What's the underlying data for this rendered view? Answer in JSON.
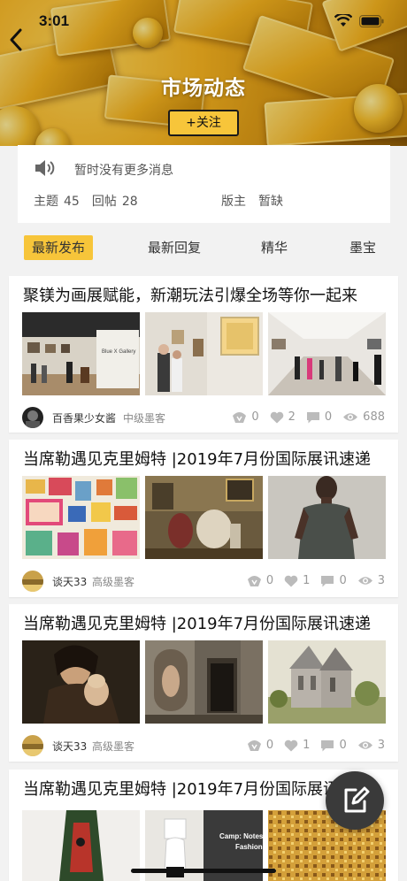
{
  "status_bar": {
    "time": "3:01",
    "signal_icon": "wifi-icon",
    "battery_icon": "battery-icon"
  },
  "header": {
    "title": "市场动态",
    "follow_label": "+关注",
    "back_icon": "chevron-left-icon",
    "background": "gold-bars-photo",
    "accent_color": "#f7c53a"
  },
  "info": {
    "notice": "暂时没有更多消息",
    "topics_label": "主题",
    "topics_count": "45",
    "replies_label": "回帖",
    "replies_count": "28",
    "moderator_label": "版主",
    "moderator_value": "暂缺"
  },
  "tabs": [
    {
      "label": "最新发布",
      "active": true
    },
    {
      "label": "最新回复",
      "active": false
    },
    {
      "label": "精华",
      "active": false
    },
    {
      "label": "墨宝",
      "active": false
    }
  ],
  "posts": [
    {
      "title": "聚镁为画展赋能，新潮玩法引爆全场等你一起来",
      "author": "百香果少女酱",
      "rank": "中级墨客",
      "gifts": "0",
      "likes": "2",
      "comments": "0",
      "views": "688",
      "gallery_sign": "Blue X Gallery"
    },
    {
      "title": "当席勒遇见克里姆特 |2019年7月份国际展讯速递",
      "author": "谈天33",
      "rank": "高级墨客",
      "gifts": "0",
      "likes": "1",
      "comments": "0",
      "views": "3"
    },
    {
      "title": "当席勒遇见克里姆特 |2019年7月份国际展讯速递",
      "author": "谈天33",
      "rank": "高级墨客",
      "gifts": "0",
      "likes": "1",
      "comments": "0",
      "views": "3"
    },
    {
      "title": "当席勒遇见克里姆特 |2019年7月份国际展讯速递",
      "book_line1": "Camp: Notes",
      "book_line2": "Fashion"
    }
  ],
  "fab": {
    "icon": "edit-icon"
  }
}
